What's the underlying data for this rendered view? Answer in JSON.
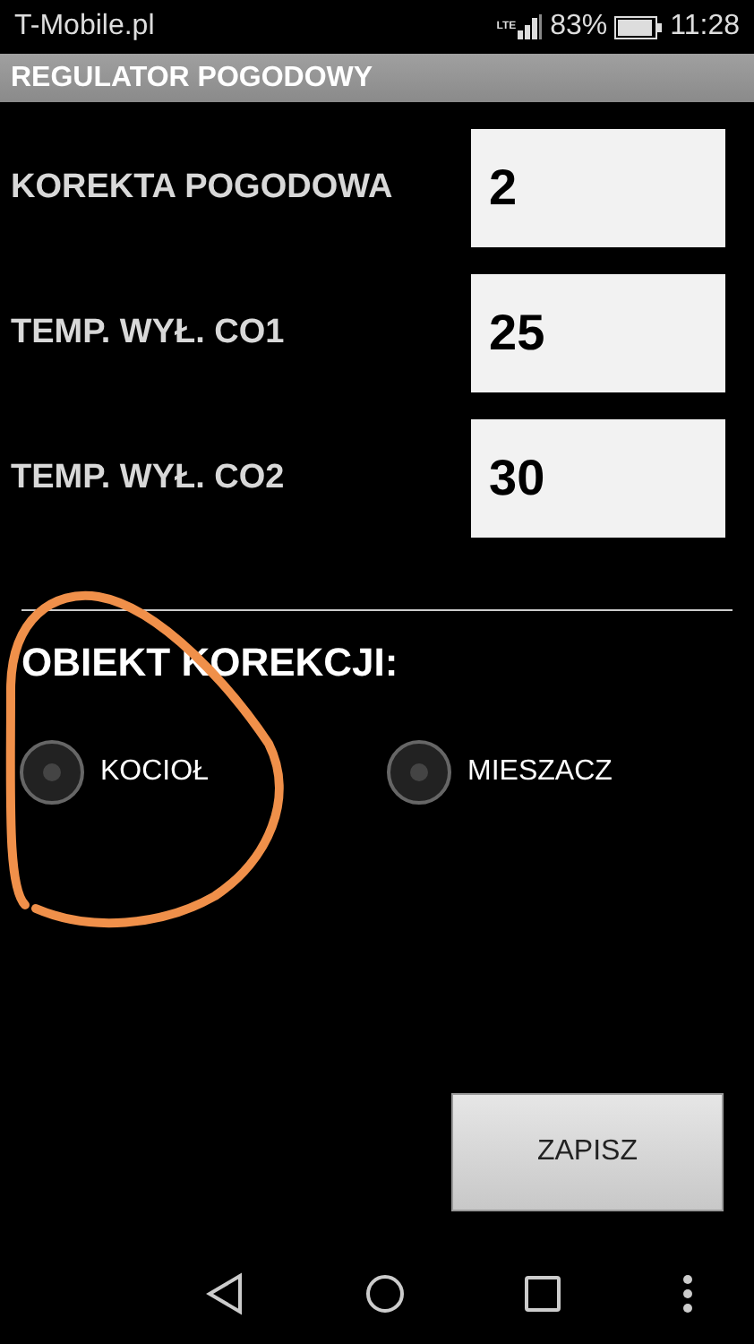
{
  "status_bar": {
    "carrier": "T-Mobile.pl",
    "network": "LTE",
    "battery": "83%",
    "time": "11:28"
  },
  "title_bar": {
    "title": "REGULATOR POGODOWY"
  },
  "fields": [
    {
      "label": "KOREKTA POGODOWA",
      "value": "2"
    },
    {
      "label": "TEMP. WYŁ. CO1",
      "value": "25"
    },
    {
      "label": "TEMP. WYŁ. CO2",
      "value": "30"
    }
  ],
  "correction": {
    "heading": "OBIEKT KOREKCJI:",
    "options": [
      {
        "label": "KOCIOŁ",
        "selected": false
      },
      {
        "label": "MIESZACZ",
        "selected": false
      }
    ]
  },
  "save_button": "ZAPISZ",
  "annotation": {
    "kind": "hand-drawn-circle"
  }
}
